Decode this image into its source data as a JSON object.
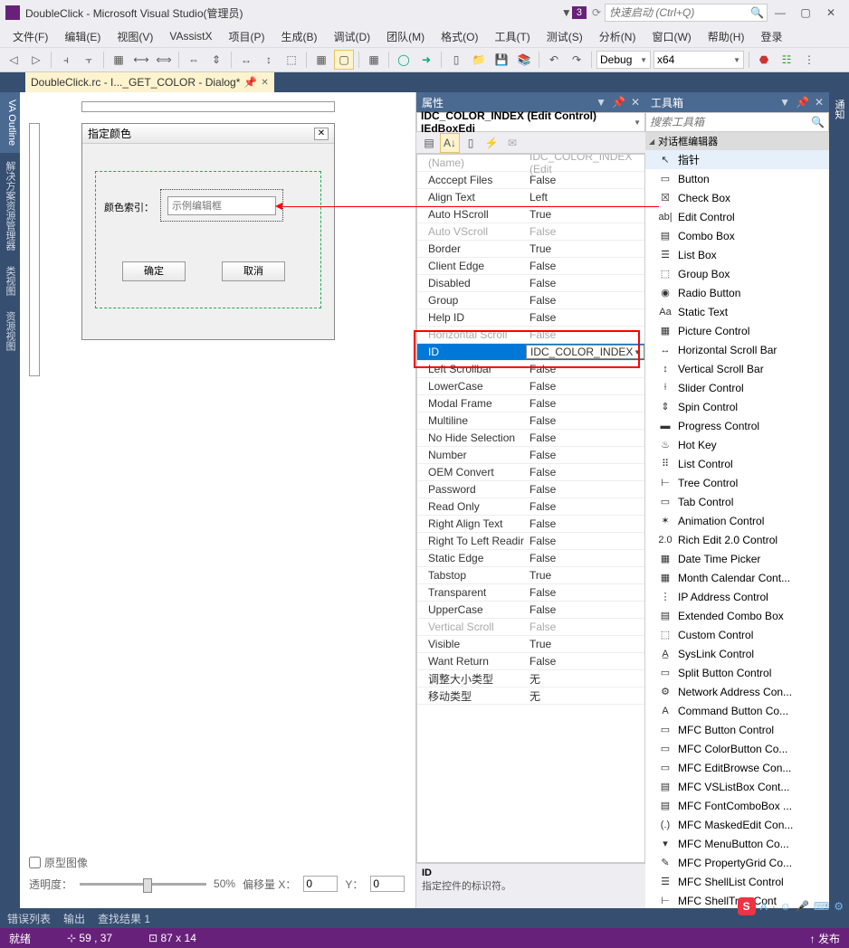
{
  "title": "DoubleClick - Microsoft Visual Studio(管理员)",
  "badge": "3",
  "quick_launch_placeholder": "快速启动 (Ctrl+Q)",
  "menus": [
    "文件(F)",
    "编辑(E)",
    "视图(V)",
    "VAssistX",
    "项目(P)",
    "生成(B)",
    "调试(D)",
    "团队(M)",
    "格式(O)",
    "工具(T)",
    "测试(S)",
    "分析(N)",
    "窗口(W)",
    "帮助(H)",
    "登录"
  ],
  "config_combo": "Debug",
  "platform_combo": "x64",
  "doc_tab": "DoubleClick.rc - I..._GET_COLOR - Dialog*",
  "left_tabs": [
    "VA Outline",
    "解决方案资源管理器",
    "类视图",
    "资源视图"
  ],
  "right_tab": "通知",
  "designer": {
    "dialog_title": "指定颜色",
    "label": "颜色索引：",
    "edit_placeholder": "示例编辑框",
    "btn_ok": "确定",
    "btn_cancel": "取消",
    "chk_raw": "原型图像",
    "lbl_opacity": "透明度：",
    "opacity_val": "50%",
    "lbl_offx": "偏移量 X：",
    "offx": "0",
    "lbl_offy": "Y：",
    "offy": "0"
  },
  "props_title": "属性",
  "props_selector": "IDC_COLOR_INDEX (Edit Control)  IEdBoxEdi",
  "props": [
    {
      "n": "(Name)",
      "v": "IDC_COLOR_INDEX (Edit",
      "d": true
    },
    {
      "n": "Acccept Files",
      "v": "False"
    },
    {
      "n": "Align Text",
      "v": "Left"
    },
    {
      "n": "Auto HScroll",
      "v": "True"
    },
    {
      "n": "Auto VScroll",
      "v": "False",
      "d": true
    },
    {
      "n": "Border",
      "v": "True"
    },
    {
      "n": "Client Edge",
      "v": "False"
    },
    {
      "n": "Disabled",
      "v": "False"
    },
    {
      "n": "Group",
      "v": "False"
    },
    {
      "n": "Help ID",
      "v": "False"
    },
    {
      "n": "Horizontal Scroll",
      "v": "False",
      "d": true
    },
    {
      "n": "ID",
      "v": "IDC_COLOR_INDEX",
      "sel": true
    },
    {
      "n": "Left Scrollbar",
      "v": "False"
    },
    {
      "n": "LowerCase",
      "v": "False"
    },
    {
      "n": "Modal Frame",
      "v": "False"
    },
    {
      "n": "Multiline",
      "v": "False"
    },
    {
      "n": "No Hide Selection",
      "v": "False"
    },
    {
      "n": "Number",
      "v": "False"
    },
    {
      "n": "OEM Convert",
      "v": "False"
    },
    {
      "n": "Password",
      "v": "False"
    },
    {
      "n": "Read Only",
      "v": "False"
    },
    {
      "n": "Right Align Text",
      "v": "False"
    },
    {
      "n": "Right To Left Readir",
      "v": "False"
    },
    {
      "n": "Static Edge",
      "v": "False"
    },
    {
      "n": "Tabstop",
      "v": "True"
    },
    {
      "n": "Transparent",
      "v": "False"
    },
    {
      "n": "UpperCase",
      "v": "False"
    },
    {
      "n": "Vertical Scroll",
      "v": "False",
      "d": true
    },
    {
      "n": "Visible",
      "v": "True"
    },
    {
      "n": "Want Return",
      "v": "False"
    },
    {
      "n": "调整大小类型",
      "v": "无"
    },
    {
      "n": "移动类型",
      "v": "无"
    }
  ],
  "prop_desc_title": "ID",
  "prop_desc_text": "指定控件的标识符。",
  "toolbox_title": "工具箱",
  "toolbox_search_placeholder": "搜索工具箱",
  "toolbox_cat": "对话框编辑器",
  "tools": [
    {
      "i": "↖",
      "l": "指针",
      "sel": true
    },
    {
      "i": "▭",
      "l": "Button"
    },
    {
      "i": "☒",
      "l": "Check Box"
    },
    {
      "i": "ab|",
      "l": "Edit Control"
    },
    {
      "i": "▤",
      "l": "Combo Box"
    },
    {
      "i": "☰",
      "l": "List Box"
    },
    {
      "i": "⬚",
      "l": "Group Box"
    },
    {
      "i": "◉",
      "l": "Radio Button"
    },
    {
      "i": "Aa",
      "l": "Static Text"
    },
    {
      "i": "▦",
      "l": "Picture Control"
    },
    {
      "i": "↔",
      "l": "Horizontal Scroll Bar"
    },
    {
      "i": "↕",
      "l": "Vertical Scroll Bar"
    },
    {
      "i": "⟊",
      "l": "Slider Control"
    },
    {
      "i": "⇕",
      "l": "Spin Control"
    },
    {
      "i": "▬",
      "l": "Progress Control"
    },
    {
      "i": "♨",
      "l": "Hot Key"
    },
    {
      "i": "⠿",
      "l": "List Control"
    },
    {
      "i": "⊢",
      "l": "Tree Control"
    },
    {
      "i": "▭",
      "l": "Tab Control"
    },
    {
      "i": "✶",
      "l": "Animation Control"
    },
    {
      "i": "2.0",
      "l": "Rich Edit 2.0 Control"
    },
    {
      "i": "▦",
      "l": "Date Time Picker"
    },
    {
      "i": "▦",
      "l": "Month Calendar Cont..."
    },
    {
      "i": "⋮",
      "l": "IP Address Control"
    },
    {
      "i": "▤",
      "l": "Extended Combo Box"
    },
    {
      "i": "⬚",
      "l": "Custom Control"
    },
    {
      "i": "A̲",
      "l": "SysLink Control"
    },
    {
      "i": "▭",
      "l": "Split Button Control"
    },
    {
      "i": "⚙",
      "l": "Network Address Con..."
    },
    {
      "i": "A",
      "l": "Command Button Co..."
    },
    {
      "i": "▭",
      "l": "MFC Button Control"
    },
    {
      "i": "▭",
      "l": "MFC ColorButton Co..."
    },
    {
      "i": "▭",
      "l": "MFC EditBrowse Con..."
    },
    {
      "i": "▤",
      "l": "MFC VSListBox Cont..."
    },
    {
      "i": "▤",
      "l": "MFC FontComboBox ..."
    },
    {
      "i": "(.)",
      "l": "MFC MaskedEdit Con..."
    },
    {
      "i": "▾",
      "l": "MFC MenuButton Co..."
    },
    {
      "i": "✎",
      "l": "MFC PropertyGrid Co..."
    },
    {
      "i": "☰",
      "l": "MFC ShellList Control"
    },
    {
      "i": "⊢",
      "l": "MFC ShellTree Cont"
    }
  ],
  "bottom_tabs": [
    "错误列表",
    "输出",
    "查找结果 1"
  ],
  "status": {
    "ready": "就绪",
    "pos": "59 , 37",
    "size": "87 x 14",
    "pub": "发布"
  }
}
